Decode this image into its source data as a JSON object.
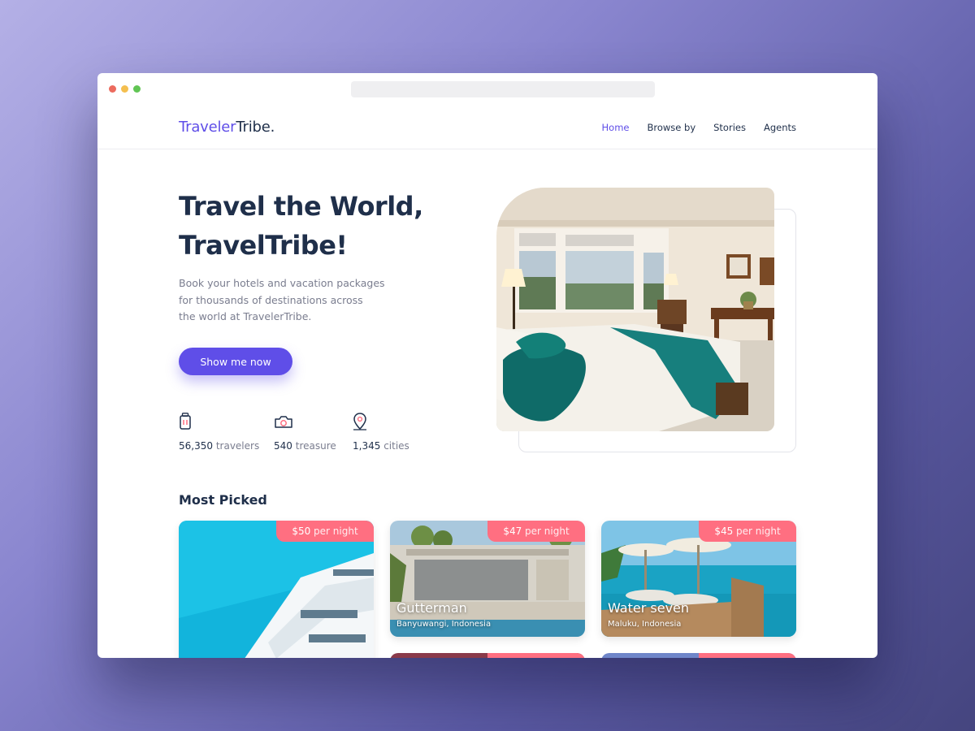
{
  "brand": {
    "part1": "Traveler",
    "part2": "Tribe."
  },
  "nav": [
    {
      "label": "Home",
      "active": true
    },
    {
      "label": "Browse by",
      "active": false
    },
    {
      "label": "Stories",
      "active": false
    },
    {
      "label": "Agents",
      "active": false
    }
  ],
  "hero": {
    "title_line1": "Travel the World,",
    "title_line2": "TravelTribe!",
    "desc_line1": "Book your hotels and vacation packages",
    "desc_line2": "for thousands of destinations across",
    "desc_line3": "the world at TravelerTribe.",
    "cta": "Show me now"
  },
  "stats": [
    {
      "value": "56,350",
      "unit": "travelers",
      "icon": "suitcase-icon"
    },
    {
      "value": "540",
      "unit": "treasure",
      "icon": "camera-icon"
    },
    {
      "value": "1,345",
      "unit": "cities",
      "icon": "map-pin-icon"
    }
  ],
  "most_picked": {
    "title": "Most Picked",
    "cards": [
      {
        "price": "$50",
        "per": "per night",
        "name": "",
        "location": ""
      },
      {
        "price": "$47",
        "per": "per night",
        "name": "Gutterman",
        "location": "Banyuwangi, Indonesia"
      },
      {
        "price": "$45",
        "per": "per night",
        "name": "Water seven",
        "location": "Maluku, Indonesia"
      }
    ]
  },
  "colors": {
    "primary": "#5f4ee8",
    "accent": "#ff6f81",
    "text": "#1f2f4a",
    "muted": "#7a7d8f"
  }
}
